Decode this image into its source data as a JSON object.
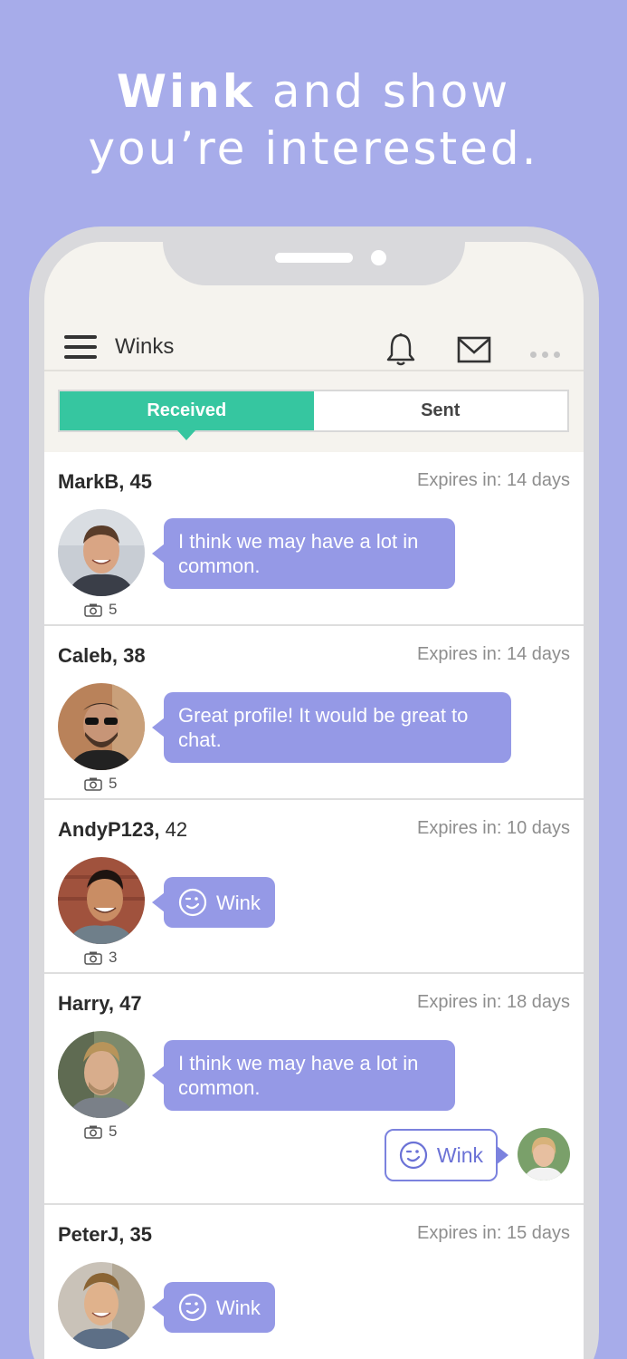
{
  "hero": {
    "bold": "Wink",
    "line1_rest": " and show",
    "line2": "you’re interested."
  },
  "header": {
    "title": "Winks"
  },
  "tabs": [
    {
      "label": "Received",
      "active": true
    },
    {
      "label": "Sent",
      "active": false
    }
  ],
  "winks": [
    {
      "name": "MarkB,",
      "age": "45",
      "expires": "Expires in: 14 days",
      "photos": "5",
      "message": "I think we may have a lot in\ncommon.",
      "type": "message"
    },
    {
      "name": "Caleb,",
      "age": "38",
      "expires": "Expires in: 14 days",
      "photos": "5",
      "message": "Great profile! It would be great to\nchat.",
      "type": "message"
    },
    {
      "name": "AndyP123,",
      "age": "42",
      "expires": "Expires in: 10 days",
      "photos": "3",
      "message": "Wink",
      "type": "wink"
    },
    {
      "name": "Harry,",
      "age": "47",
      "expires": "Expires in: 18 days",
      "photos": "5",
      "message": "I think we may have a lot in\ncommon.",
      "type": "message",
      "reply": "Wink"
    },
    {
      "name": "PeterJ,",
      "age": "35",
      "expires": "Expires in: 15 days",
      "photos": "",
      "message": "Wink",
      "type": "wink"
    }
  ],
  "colors": {
    "background": "#a7acea",
    "accent": "#36c6a0",
    "bubble": "#9599e6"
  }
}
